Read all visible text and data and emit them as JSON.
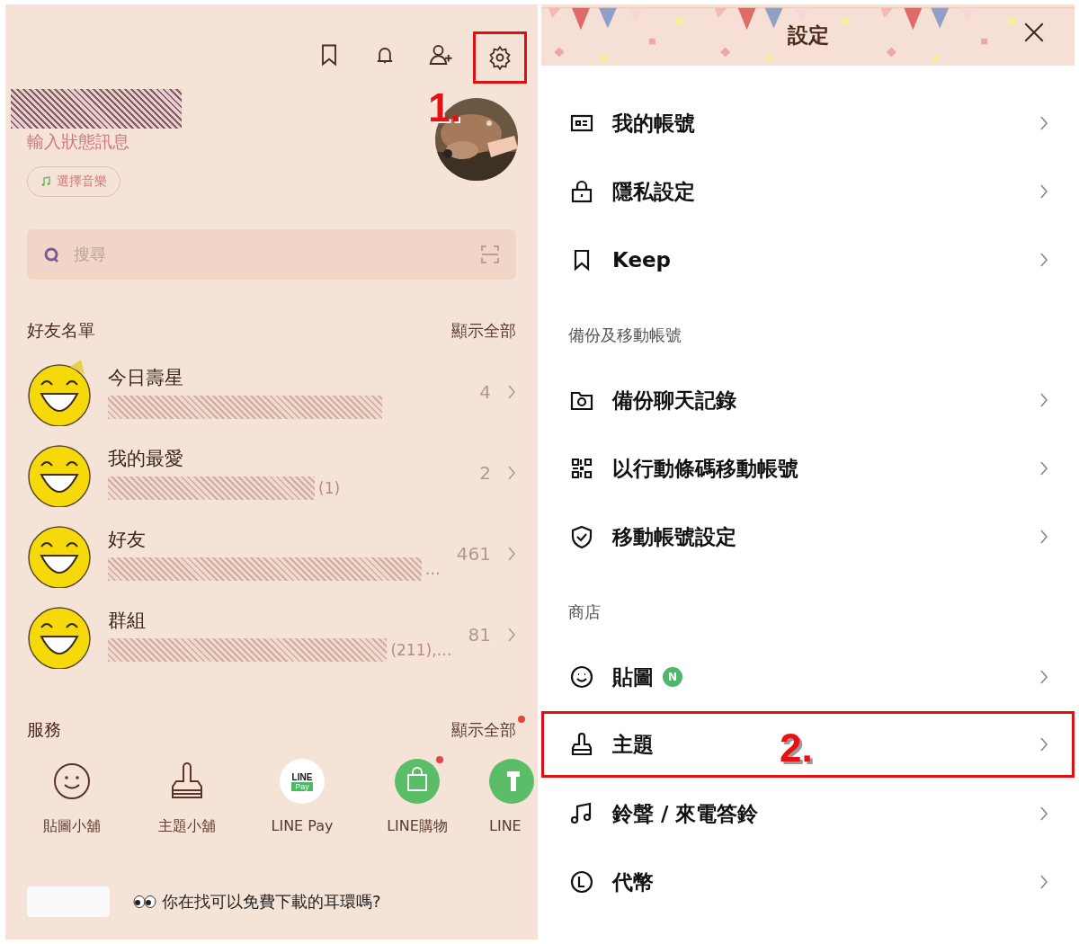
{
  "home": {
    "toolbar": [
      {
        "kind": "bookmark",
        "highlighted": false
      },
      {
        "kind": "bell",
        "highlighted": false
      },
      {
        "kind": "add-friend",
        "highlighted": false
      },
      {
        "kind": "gear",
        "highlighted": true,
        "annotation": "1."
      }
    ],
    "profile": {
      "status_placeholder": "輸入狀態訊息",
      "music_button": "選擇音樂"
    },
    "search": {
      "placeholder": "搜尋"
    },
    "friends": {
      "title": "好友名單",
      "show_all": "顯示全部",
      "rows": [
        {
          "name": "今日壽星",
          "preview": "",
          "count": "4",
          "birthday": true
        },
        {
          "name": "我的最愛",
          "preview": "(1)",
          "count": "2",
          "birthday": false
        },
        {
          "name": "好友",
          "preview": "…",
          "count": "461",
          "birthday": false
        },
        {
          "name": "群組",
          "preview": "(211),…",
          "count": "81",
          "birthday": false
        }
      ]
    },
    "services": {
      "title": "服務",
      "show_all": "顯示全部",
      "show_all_dot": true,
      "items": [
        {
          "kind": "sticker",
          "label": "貼圖小舖",
          "dot": false
        },
        {
          "kind": "theme",
          "label": "主題小舖",
          "dot": false
        },
        {
          "kind": "pay",
          "label": "LINE Pay",
          "logo_text": [
            "LINE",
            "Pay"
          ],
          "dot": false
        },
        {
          "kind": "shopping",
          "label": "LINE購物",
          "dot": true
        },
        {
          "kind": "partial",
          "label": "LINE",
          "dot": false
        }
      ]
    },
    "article": {
      "title": "你在找可以免費下載的耳環嗎?"
    }
  },
  "settings": {
    "title": "設定",
    "sections": [
      {
        "items": [
          {
            "label": "我的帳號",
            "new": false,
            "highlighted": false
          },
          {
            "label": "隱私設定",
            "new": false,
            "highlighted": false
          },
          {
            "label": "Keep",
            "new": false,
            "highlighted": false
          }
        ]
      },
      {
        "title": "備份及移動帳號",
        "items": [
          {
            "label": "備份聊天記錄",
            "new": false,
            "highlighted": false
          },
          {
            "label": "以行動條碼移動帳號",
            "new": false,
            "highlighted": false
          },
          {
            "label": "移動帳號設定",
            "new": false,
            "highlighted": false
          }
        ]
      },
      {
        "title": "商店",
        "items": [
          {
            "label": "貼圖",
            "new": true,
            "new_badge": "N",
            "highlighted": false
          },
          {
            "label": "主題",
            "new": false,
            "highlighted": true,
            "annotation": "2."
          },
          {
            "label": "鈴聲 / 來電答鈴",
            "new": false,
            "highlighted": false
          },
          {
            "label": "代幣",
            "new": false,
            "highlighted": false
          }
        ]
      }
    ]
  }
}
